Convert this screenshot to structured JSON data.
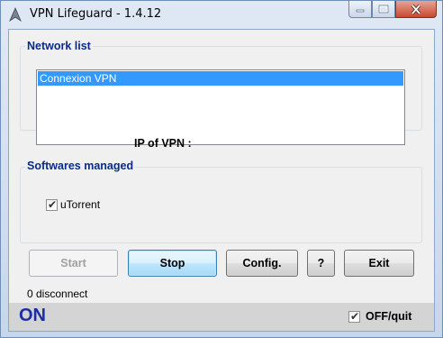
{
  "window": {
    "title": "VPN Lifeguard - 1.4.12",
    "icons": {
      "app": "vpn-app-icon",
      "minimize": "minimize-icon",
      "maximize": "maximize-icon",
      "close": "close-icon"
    }
  },
  "network_list": {
    "label": "Network list",
    "items": [
      "Connexion VPN"
    ],
    "selected_index": 0
  },
  "ip": {
    "label": "IP of VPN :"
  },
  "softwares": {
    "label": "Softwares managed",
    "items": [
      {
        "label": "uTorrent",
        "checked": true
      }
    ]
  },
  "buttons": {
    "start": "Start",
    "stop": "Stop",
    "config": "Config.",
    "help": "?",
    "exit": "Exit"
  },
  "status": {
    "disconnect_count": "0 disconnect",
    "state": "ON",
    "state_color": "#1a2fa5",
    "off_quit_label": "OFF/quit",
    "off_quit_checked": true
  },
  "colors": {
    "group_label": "#0a2a8c",
    "selection": "#3399ff",
    "close_button": "#c54a31"
  }
}
